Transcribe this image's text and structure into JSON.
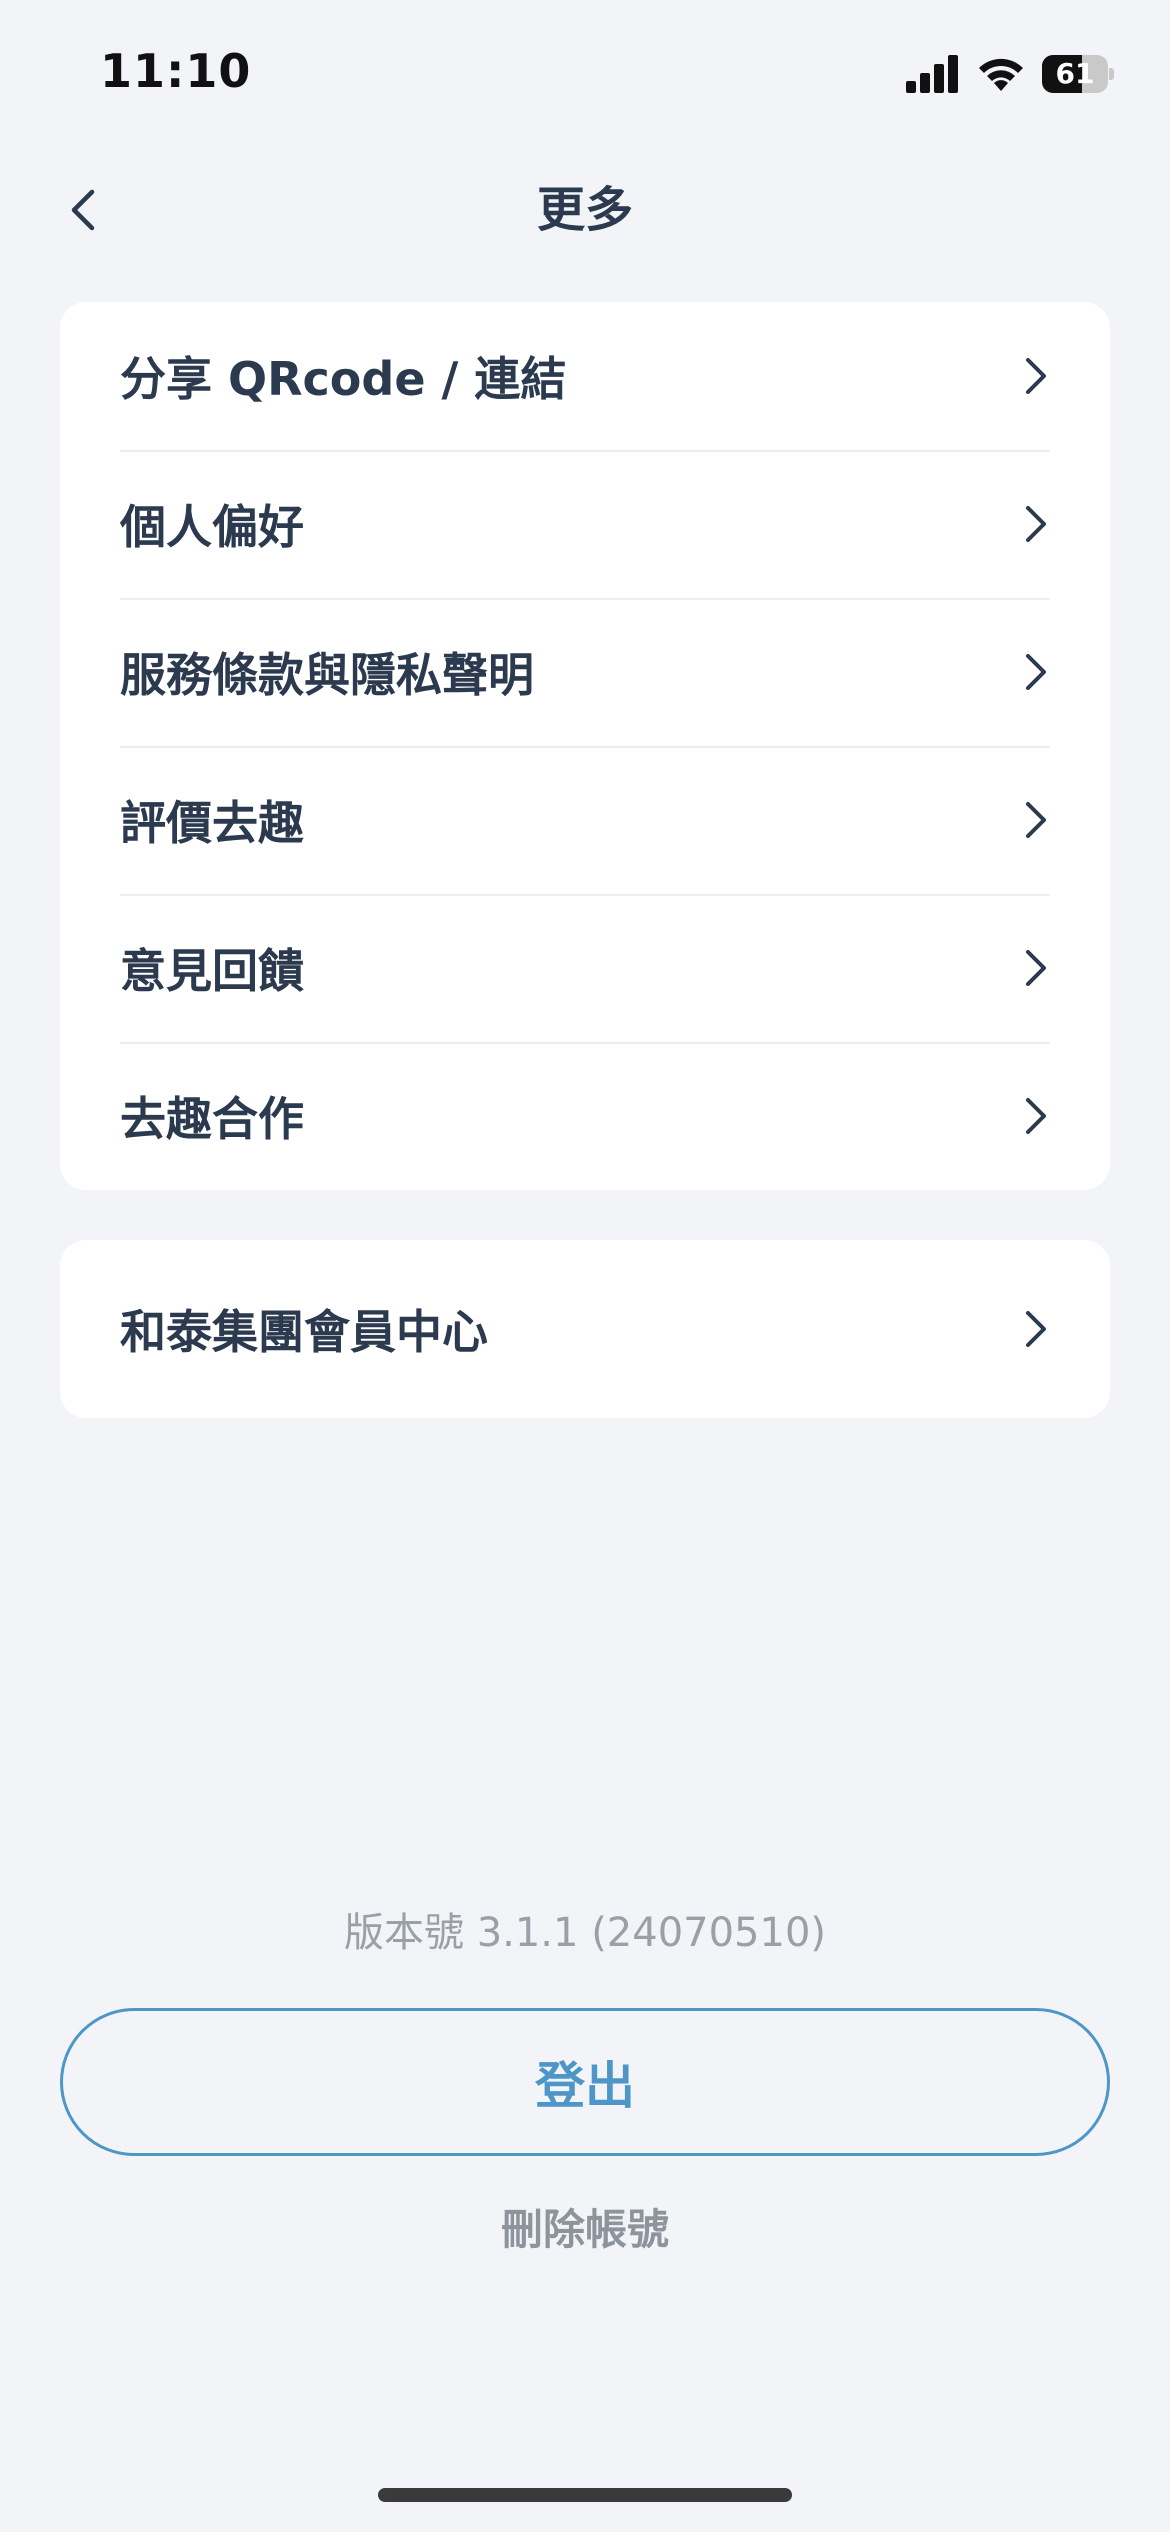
{
  "status_bar": {
    "time": "11:10",
    "battery_level": "61",
    "battery_fraction": 0.61
  },
  "nav": {
    "title": "更多",
    "back_icon": "chevron-left-icon"
  },
  "menu_main": {
    "items": [
      {
        "label": "分享 QRcode / 連結"
      },
      {
        "label": "個人偏好"
      },
      {
        "label": "服務條款與隱私聲明"
      },
      {
        "label": "評價去趣"
      },
      {
        "label": "意見回饋"
      },
      {
        "label": "去趣合作"
      }
    ]
  },
  "menu_secondary": {
    "items": [
      {
        "label": "和泰集團會員中心"
      }
    ]
  },
  "footer": {
    "version": "版本號 3.1.1 (24070510)",
    "logout_label": "登出",
    "delete_account_label": "刪除帳號"
  },
  "colors": {
    "background": "#F2F4F8",
    "card": "#FFFFFF",
    "text_primary": "#2B3A4E",
    "accent": "#4E96C8",
    "text_muted": "#9AA0A8"
  }
}
